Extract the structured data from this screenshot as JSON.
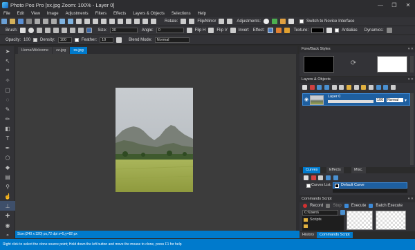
{
  "app": {
    "title": "Photo Pos Pro [xx.jpg Zoom: 100% - Layer 0]"
  },
  "window_controls": {
    "minimize": "—",
    "maximize": "❐",
    "close": "✕"
  },
  "menu": [
    "File",
    "Edit",
    "View",
    "Image",
    "Adjustments",
    "Filters",
    "Effects",
    "Layers & Objects",
    "Selections",
    "Help"
  ],
  "toolbar1": {
    "rotate_label": "Rotate:",
    "flip_label": "Flip/Mirror",
    "adjustments_label": "Adjustments:",
    "novice_label": "Switch to Novice Interface"
  },
  "toolbar2": {
    "brush_label": "Brush:",
    "size_label": "Size:",
    "size_value": "30",
    "angle_label": "Angle:",
    "angle_value": "0",
    "fliph_label": "Flip H",
    "flipv_label": "Flip V",
    "invert_label": "Invert",
    "effect_label": "Effect:",
    "texture_label": "Texture:",
    "antialias_label": "Antialias",
    "dynamics_label": "Dynamics:"
  },
  "toolbar3": {
    "opacity_label": "Opacity:",
    "opacity_value": "100",
    "density_label": "Density:",
    "density_value": "100",
    "feather_label": "Feather:",
    "feather_value": "10",
    "blend_label": "Blend Mode:",
    "blend_value": "Normal"
  },
  "doc_tabs": [
    "Home/Welcome",
    "zz.jpg",
    "xx.jpg"
  ],
  "canvas_status": "Size:(240 x 320) px,72 dpi   x=5,y=82 px",
  "status_bar": "Right click to select the clone source point; Hold down the left button and move the mouse to clone, press F1 for help",
  "panels": {
    "fore_back": {
      "title": "Fore/Back Styles"
    },
    "layers": {
      "title": "Layers & Objects",
      "layer_name": "Layer 0",
      "opacity": "100",
      "blend": "Normal"
    },
    "curves_tabs": [
      "Curves",
      "Effects",
      "Misc."
    ],
    "curves_list_label": "Curves List:",
    "curves_selected": "Default Curve",
    "commands": {
      "title": "Commands Script",
      "record": "Record",
      "stop": "Stop",
      "execute": "Execute",
      "batch": "Batch Execute",
      "path": "C:\\Users\\",
      "folder": "Scripts"
    },
    "bottom_tabs": [
      "History",
      "Commands Script"
    ]
  },
  "colors": {
    "accent": "#007acc",
    "bg": "#2b2b2b",
    "canvas": "#3c3c3c"
  },
  "icons": {
    "tools": [
      "arrow-icon",
      "move-icon",
      "crop-icon",
      "magic-wand-icon",
      "lasso-icon",
      "rect-select-icon",
      "brush-icon",
      "pencil-icon",
      "eraser-icon",
      "text-icon",
      "pen-icon",
      "shape-icon",
      "gradient-icon",
      "fill-icon",
      "dropper-icon",
      "clone-stamp-icon",
      "smudge-icon",
      "eye-icon",
      "zoom-icon"
    ]
  }
}
